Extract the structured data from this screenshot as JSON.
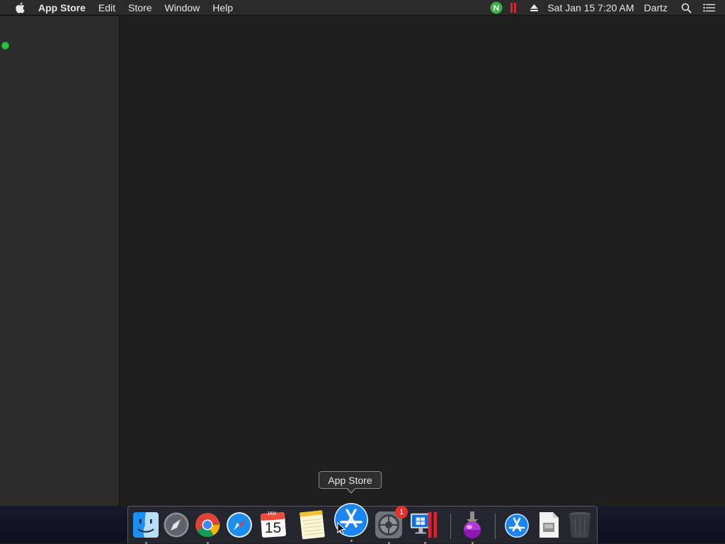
{
  "menubar": {
    "app_name": "App Store",
    "items": [
      "Edit",
      "Store",
      "Window",
      "Help"
    ],
    "clock": "Sat Jan 15  7:20 AM",
    "user": "Dartz",
    "status_icons": [
      "nordvpn-icon",
      "parallels-icon",
      "eject-icon",
      "spotlight-search-icon",
      "notification-center-icon"
    ]
  },
  "tooltip": {
    "label": "App Store"
  },
  "dock": {
    "items": [
      {
        "name": "finder-icon",
        "running": true
      },
      {
        "name": "launchpad-icon",
        "running": false
      },
      {
        "name": "chrome-icon",
        "running": true
      },
      {
        "name": "safari-icon",
        "running": false
      },
      {
        "name": "calendar-icon",
        "running": false,
        "month": "JAN",
        "day": "15"
      },
      {
        "name": "notes-icon",
        "running": false
      },
      {
        "name": "app-store-icon",
        "running": true
      },
      {
        "name": "system-preferences-icon",
        "running": true,
        "badge": "1"
      },
      {
        "name": "parallels-desktop-icon",
        "running": true
      },
      {
        "name": "downloads-installer-icon",
        "running": true
      },
      {
        "name": "app-store-folder-icon",
        "running": false
      },
      {
        "name": "document-icon",
        "running": false
      },
      {
        "name": "trash-icon",
        "running": false
      }
    ]
  },
  "colors": {
    "menubar_bg": "#2b2b2b",
    "window_bg": "#1f1f1f",
    "sidebar_bg": "#2b2b2b",
    "traffic_green": "#29c140",
    "badge_red": "#e4312b",
    "parallels_red": "#e0202a",
    "nord_green": "#3fae49"
  }
}
